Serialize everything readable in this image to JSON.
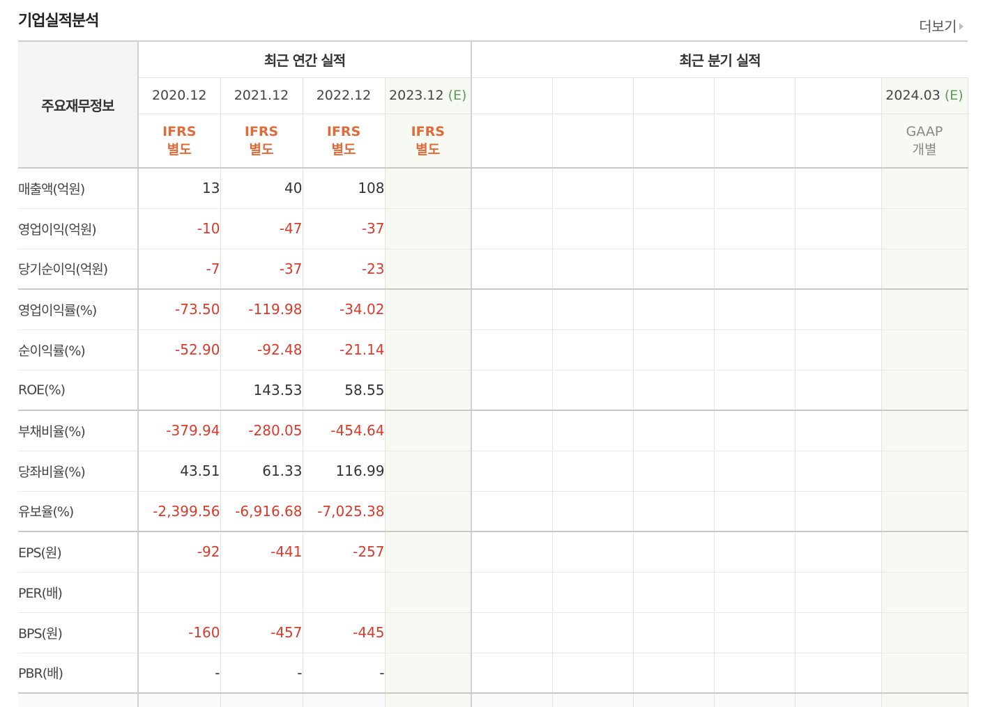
{
  "header": {
    "title": "기업실적분석",
    "more_label": "더보기"
  },
  "table": {
    "row_header_label": "주요재무정보",
    "annual_group_label": "최근 연간 실적",
    "quarter_group_label": "최근 분기 실적",
    "annual_periods": [
      {
        "label": "2020.12",
        "est": ""
      },
      {
        "label": "2021.12",
        "est": ""
      },
      {
        "label": "2022.12",
        "est": ""
      },
      {
        "label": "2023.12",
        "est": "(E)"
      }
    ],
    "quarter_periods": [
      {
        "label": "",
        "est": ""
      },
      {
        "label": "",
        "est": ""
      },
      {
        "label": "",
        "est": ""
      },
      {
        "label": "",
        "est": ""
      },
      {
        "label": "",
        "est": ""
      },
      {
        "label": "2024.03",
        "est": "(E)"
      }
    ],
    "annual_accounting": [
      {
        "line1": "IFRS",
        "line2": "별도"
      },
      {
        "line1": "IFRS",
        "line2": "별도"
      },
      {
        "line1": "IFRS",
        "line2": "별도"
      },
      {
        "line1": "IFRS",
        "line2": "별도"
      }
    ],
    "quarter_accounting_last": {
      "line1": "GAAP",
      "line2": "개별"
    },
    "rows": [
      {
        "label": "매출액(억원)",
        "values": [
          "13",
          "40",
          "108"
        ]
      },
      {
        "label": "영업이익(억원)",
        "values": [
          "-10",
          "-47",
          "-37"
        ]
      },
      {
        "label": "당기순이익(억원)",
        "values": [
          "-7",
          "-37",
          "-23"
        ]
      },
      {
        "label": "영업이익률(%)",
        "values": [
          "-73.50",
          "-119.98",
          "-34.02"
        ]
      },
      {
        "label": "순이익률(%)",
        "values": [
          "-52.90",
          "-92.48",
          "-21.14"
        ]
      },
      {
        "label": "ROE(%)",
        "values": [
          "",
          "143.53",
          "58.55"
        ]
      },
      {
        "label": "부채비율(%)",
        "values": [
          "-379.94",
          "-280.05",
          "-454.64"
        ]
      },
      {
        "label": "당좌비율(%)",
        "values": [
          "43.51",
          "61.33",
          "116.99"
        ]
      },
      {
        "label": "유보율(%)",
        "values": [
          "-2,399.56",
          "-6,916.68",
          "-7,025.38"
        ]
      },
      {
        "label": "EPS(원)",
        "values": [
          "-92",
          "-441",
          "-257"
        ]
      },
      {
        "label": "PER(배)",
        "values": [
          "",
          "",
          ""
        ]
      },
      {
        "label": "BPS(원)",
        "values": [
          "-160",
          "-457",
          "-445"
        ]
      },
      {
        "label": "PBR(배)",
        "values": [
          "-",
          "-",
          "-"
        ]
      }
    ]
  },
  "colors": {
    "negative": "#d93a2a",
    "ifrs": "#e06b3a",
    "estimate": "#5a9a5a",
    "estimate_bg": "#f6faf3"
  }
}
